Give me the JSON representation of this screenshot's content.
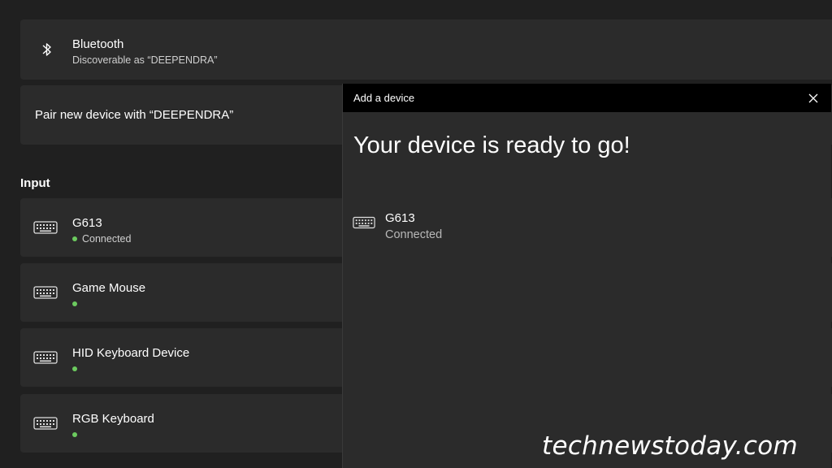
{
  "bluetooth": {
    "icon": "bluetooth-icon",
    "title": "Bluetooth",
    "subtitle": "Discoverable as “DEEPENDRA”"
  },
  "pair": {
    "label": "Pair new device with “DEEPENDRA”"
  },
  "input_section": {
    "title": "Input",
    "devices": [
      {
        "name": "G613",
        "status": "Connected",
        "icon": "keyboard-icon"
      },
      {
        "name": "Game Mouse",
        "status": "",
        "icon": "keyboard-icon"
      },
      {
        "name": "HID Keyboard Device",
        "status": "",
        "icon": "keyboard-icon"
      },
      {
        "name": "RGB Keyboard",
        "status": "",
        "icon": "keyboard-icon"
      }
    ]
  },
  "dialog": {
    "title": "Add a device",
    "heading": "Your device is ready to go!",
    "device": {
      "name": "G613",
      "status": "Connected",
      "icon": "keyboard-icon"
    },
    "close_icon": "close-icon"
  },
  "watermark": "technewstoday.com",
  "colors": {
    "background": "#202020",
    "card": "#2b2b2b",
    "dialog_header": "#000000",
    "connected_dot": "#6ccb5f",
    "accent": "#4ea1e6"
  }
}
